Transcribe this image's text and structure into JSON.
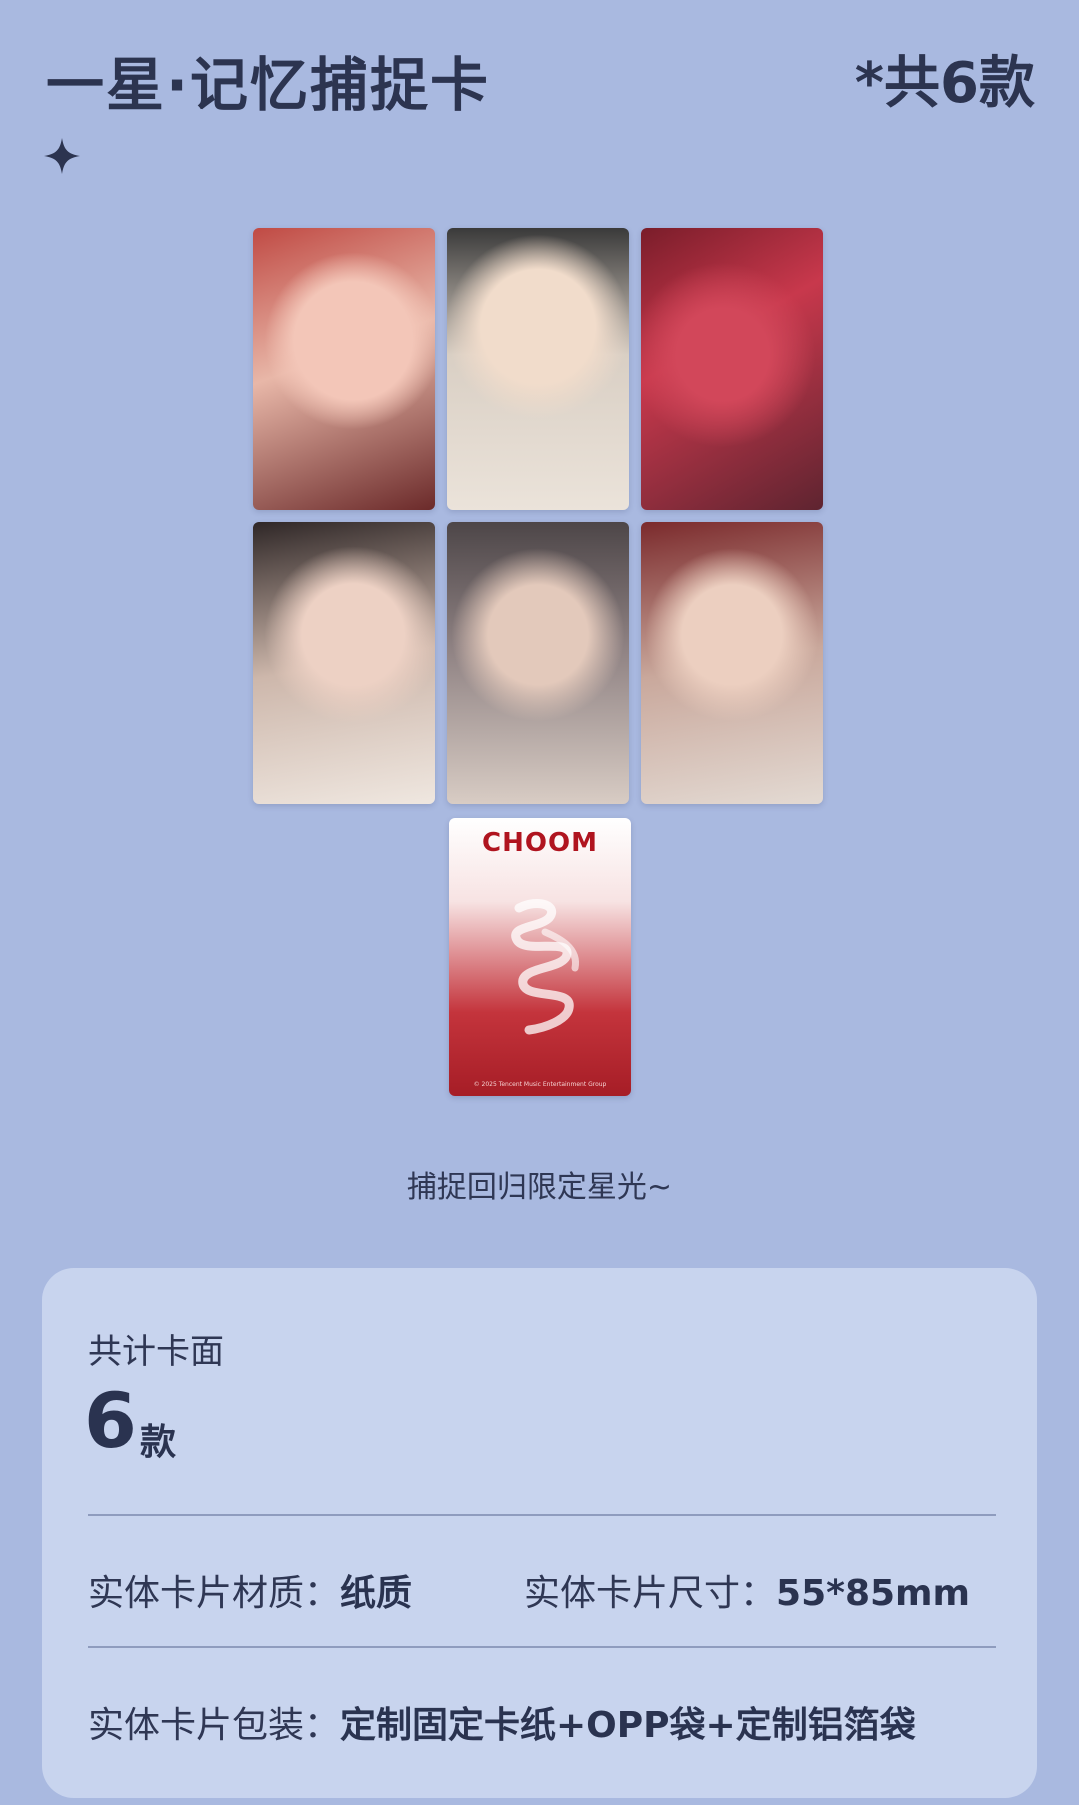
{
  "header": {
    "title": "一星·记忆捕捉卡",
    "count": "*共6款"
  },
  "cards": {
    "back_title": "CHOOM",
    "back_footer": "© 2025 Tencent Music Entertainment Group"
  },
  "caption": "捕捉回归限定星光~",
  "details": {
    "total_label": "共计卡面",
    "total_number": "6",
    "total_unit": "款",
    "material_label": "实体卡片材质：",
    "material_value": "纸质",
    "size_label": "实体卡片尺寸：",
    "size_value": "55*85mm",
    "packaging_label": "实体卡片包装：",
    "packaging_value": "定制固定卡纸+OPP袋+定制铝箔袋"
  },
  "colors": {
    "background": "#a9b9e0",
    "panel": "#c8d4ee",
    "text": "#2d3550",
    "card_back_red": "#b0141f"
  }
}
